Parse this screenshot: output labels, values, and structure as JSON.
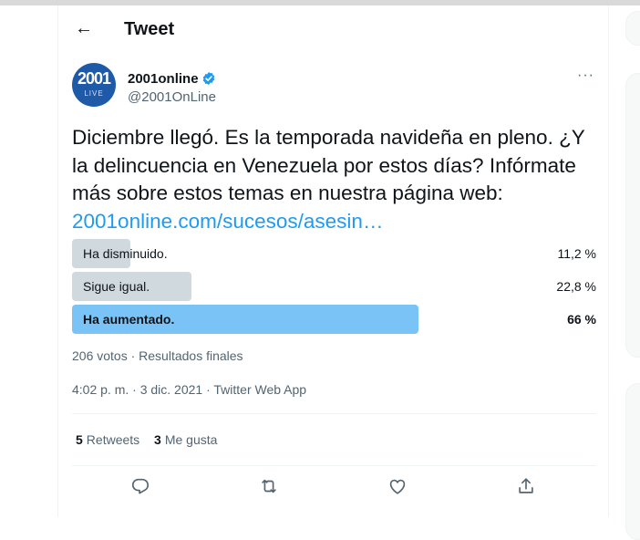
{
  "header": {
    "title": "Tweet"
  },
  "author": {
    "name": "2001online",
    "handle": "@2001OnLine",
    "avatar_text": "2001",
    "avatar_subtext": "LIVE"
  },
  "tweet": {
    "text": "Diciembre llegó. Es la temporada navideña en pleno. ¿Y la delincuencia en Venezuela por estos días? Infórmate más sobre estos temas en nuestra página web:",
    "link": "2001online.com/sucesos/asesin…"
  },
  "poll": {
    "options": [
      {
        "label": "Ha disminuido.",
        "percent_text": "11,2 %",
        "percent": 11.2,
        "winner": false
      },
      {
        "label": "Sigue igual.",
        "percent_text": "22,8 %",
        "percent": 22.8,
        "winner": false
      },
      {
        "label": "Ha aumentado.",
        "percent_text": "66 %",
        "percent": 66,
        "winner": true
      }
    ],
    "meta": "206 votos · Resultados finales"
  },
  "timestamp": "4:02 p. m. · 3 dic. 2021 · Twitter Web App",
  "stats": {
    "retweets_count": "5",
    "retweets_label": "Retweets",
    "likes_count": "3",
    "likes_label": "Me gusta"
  },
  "actions": [
    "reply-icon",
    "retweet-icon",
    "like-icon",
    "share-icon"
  ],
  "colors": {
    "accent": "#1d9bf0",
    "poll_bar": "#cfd9de",
    "poll_winner": "#79c3f6",
    "verified": "#1d9bf0",
    "avatar_bg": "#1f5aa8"
  }
}
